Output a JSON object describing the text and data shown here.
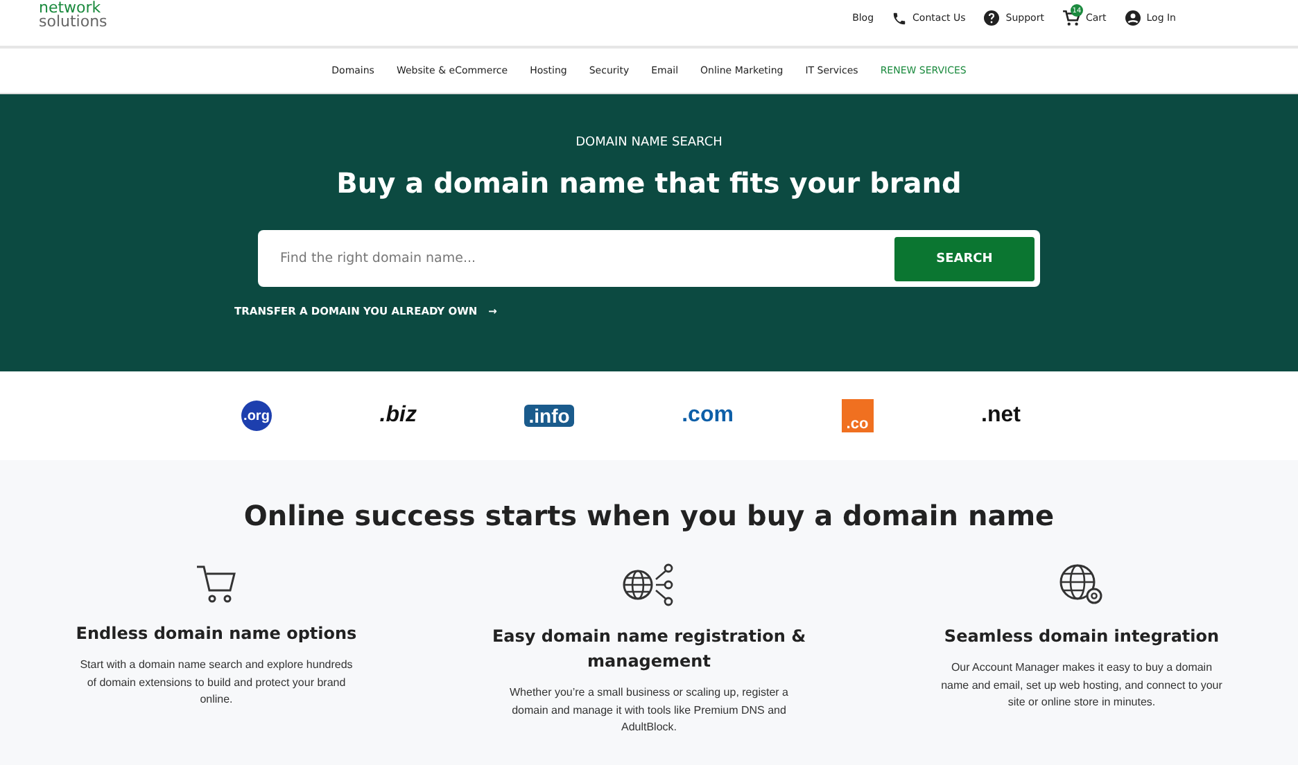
{
  "logo": {
    "line1": "network",
    "line2": "solutions"
  },
  "top_links": [
    {
      "kind": "plain",
      "label": "Blog"
    },
    {
      "kind": "phone",
      "label": "Contact Us"
    },
    {
      "kind": "help",
      "label": "Support"
    },
    {
      "kind": "cart",
      "label": "Cart",
      "badge": "14"
    },
    {
      "kind": "user",
      "label": "Log In"
    }
  ],
  "nav": [
    {
      "label": "Domains",
      "highlight": false
    },
    {
      "label": "Website & eCommerce",
      "highlight": false
    },
    {
      "label": "Hosting",
      "highlight": false
    },
    {
      "label": "Security",
      "highlight": false
    },
    {
      "label": "Email",
      "highlight": false
    },
    {
      "label": "Online Marketing",
      "highlight": false
    },
    {
      "label": "IT Services",
      "highlight": false
    },
    {
      "label": "RENEW SERVICES",
      "highlight": true
    }
  ],
  "hero": {
    "eyebrow": "DOMAIN NAME SEARCH",
    "title": "Buy a domain name that fits your brand",
    "search": {
      "placeholder": "Find the right domain name...",
      "button": "SEARCH"
    },
    "transfer": {
      "label": "TRANSFER A DOMAIN YOU ALREADY OWN",
      "arrow": "→"
    }
  },
  "tlds": [
    {
      "kind": "org",
      "label": ".org"
    },
    {
      "kind": "biz",
      "label": ".biz"
    },
    {
      "kind": "info",
      "label": ".info"
    },
    {
      "kind": "com",
      "label": ".com"
    },
    {
      "kind": "co",
      "label": ".co"
    },
    {
      "kind": "net",
      "label": ".net"
    }
  ],
  "features": {
    "title": "Online success starts when you buy a domain name",
    "items": [
      {
        "kind": "cart",
        "title": "Endless domain name options",
        "text": "Start with a domain name search and explore hundreds of domain extensions to build and protect your brand online."
      },
      {
        "kind": "share",
        "title": "Easy domain name registration & management",
        "text": "Whether you’re a small business or scaling up, register a domain and manage it with tools like Premium DNS and AdultBlock."
      },
      {
        "kind": "gear",
        "title": "Seamless domain integration",
        "text": "Our Account Manager makes it easy to buy a domain name and email, set up web hosting, and connect to your site or online store in minutes."
      }
    ]
  }
}
